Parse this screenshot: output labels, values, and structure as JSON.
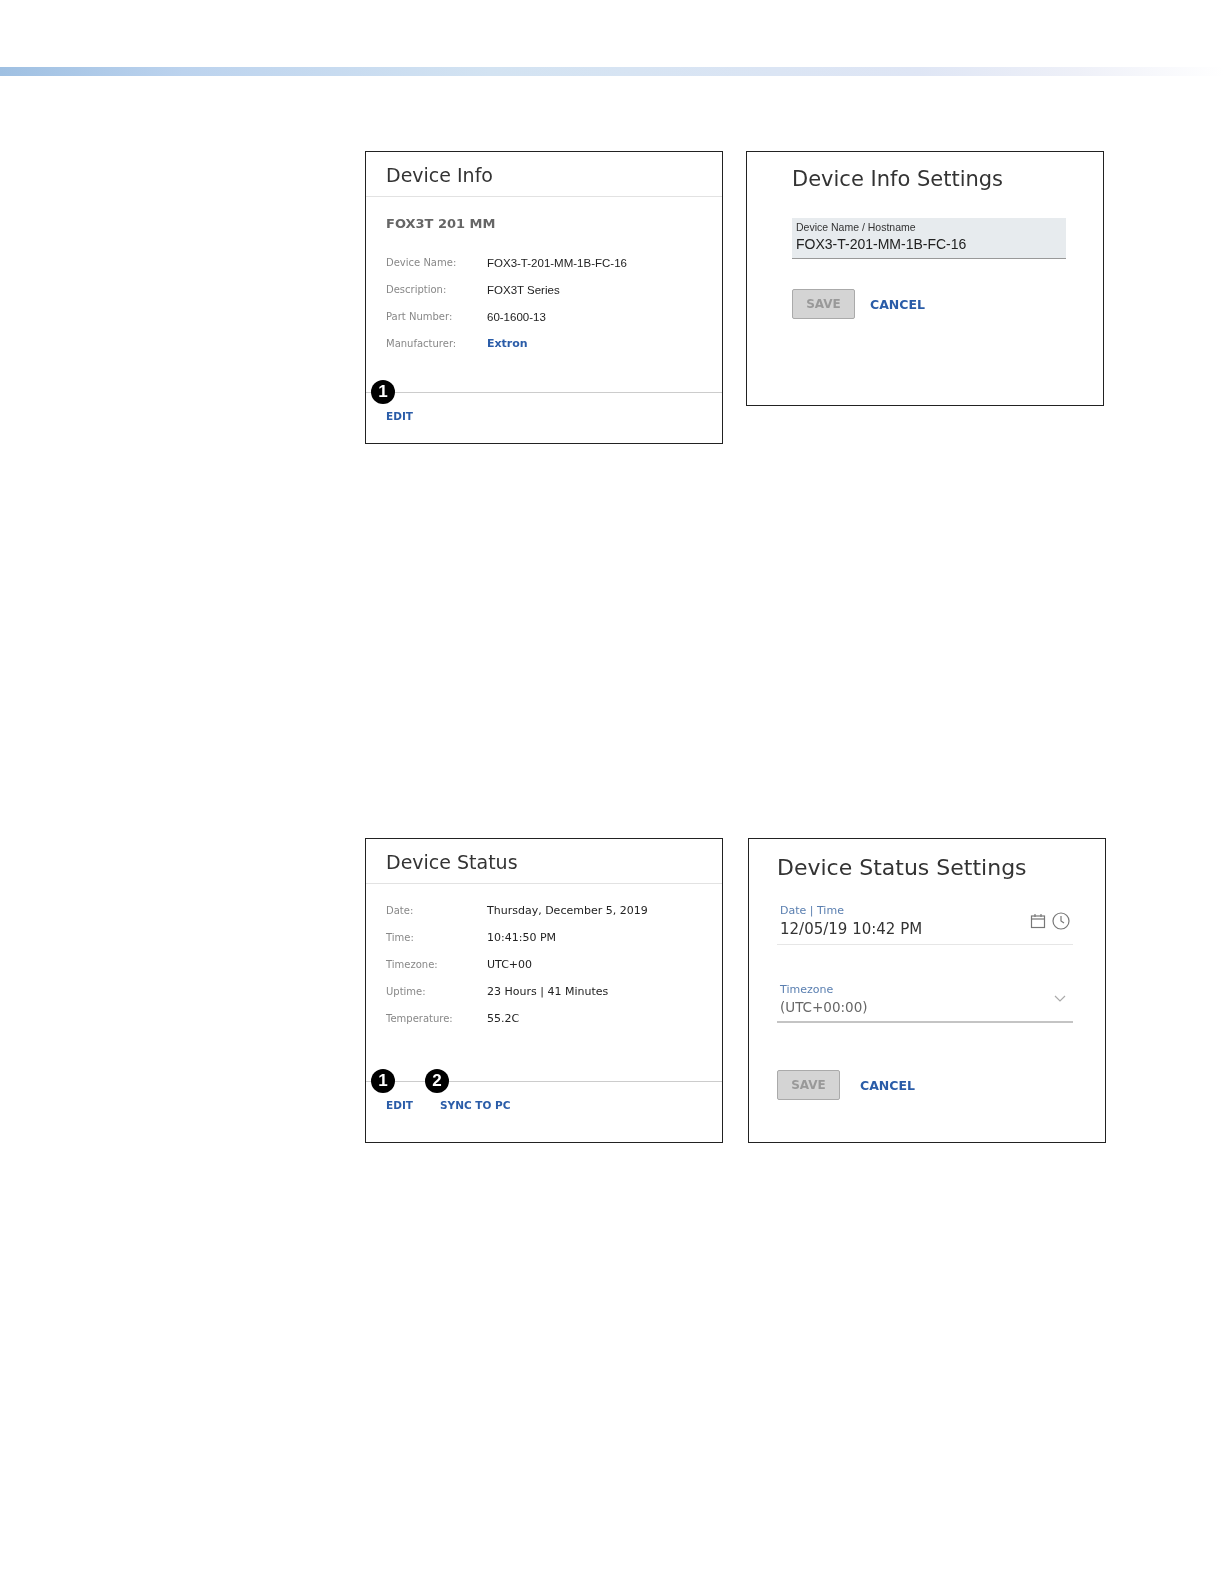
{
  "device_info": {
    "title": "Device Info",
    "model": "FOX3T 201 MM",
    "rows": [
      {
        "label": "Device Name:",
        "value": "FOX3-T-201-MM-1B-FC-16",
        "kind": "text"
      },
      {
        "label": "Description:",
        "value": "FOX3T Series",
        "kind": "text"
      },
      {
        "label": "Part Number:",
        "value": "60-1600-13",
        "kind": "text"
      },
      {
        "label": "Manufacturer:",
        "value": "Extron",
        "kind": "link"
      }
    ],
    "actions": [
      {
        "label": "EDIT",
        "callout": "1"
      }
    ]
  },
  "device_info_settings": {
    "title": "Device Info Settings",
    "field": {
      "label": "Device Name / Hostname",
      "value": "FOX3-T-201-MM-1B-FC-16"
    },
    "save": {
      "label": "SAVE",
      "disabled": true
    },
    "cancel": "CANCEL"
  },
  "device_status": {
    "title": "Device Status",
    "rows": [
      {
        "label": "Date:",
        "value": "Thursday, December 5, 2019"
      },
      {
        "label": "Time:",
        "value": "10:41:50 PM"
      },
      {
        "label": "Timezone:",
        "value": "UTC+00"
      },
      {
        "label": "Uptime:",
        "value": "23 Hours | 41 Minutes"
      },
      {
        "label": "Temperature:",
        "value": "55.2C"
      }
    ],
    "actions": [
      {
        "label": "EDIT",
        "callout": "1"
      },
      {
        "label": "SYNC TO PC",
        "callout": "2"
      }
    ]
  },
  "device_status_settings": {
    "title": "Device Status Settings",
    "datetime": {
      "label": "Date | Time",
      "value": "12/05/19 10:42 PM"
    },
    "timezone": {
      "label": "Timezone",
      "value": "(UTC+00:00)"
    },
    "save": {
      "label": "SAVE",
      "disabled": true
    },
    "cancel": "CANCEL"
  }
}
